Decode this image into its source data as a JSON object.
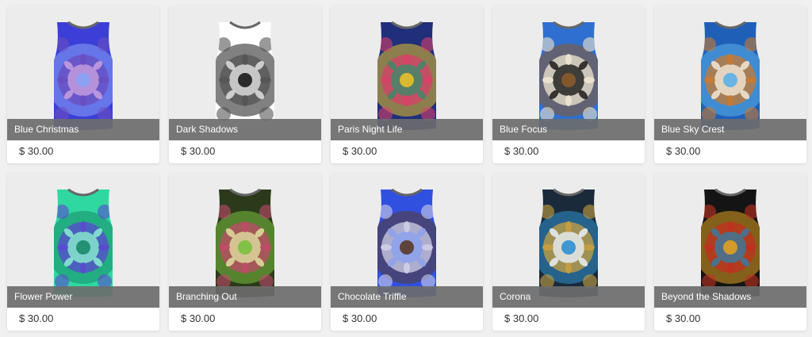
{
  "products": [
    {
      "name": "Blue Christmas",
      "price": "$ 30.00",
      "colors": [
        "#3b3fd8",
        "#8aa2f5",
        "#6a4ec0",
        "#c8a0e0"
      ]
    },
    {
      "name": "Dark Shadows",
      "price": "$ 30.00",
      "colors": [
        "#ffffff",
        "#1a1a1a",
        "#555555",
        "#e0e0e0"
      ]
    },
    {
      "name": "Paris Night Life",
      "price": "$ 30.00",
      "colors": [
        "#1f2f7a",
        "#e8c02a",
        "#d8406a",
        "#3a8a6a"
      ]
    },
    {
      "name": "Blue Focus",
      "price": "$ 30.00",
      "colors": [
        "#2f6fd0",
        "#8a5a2a",
        "#f0e6d0",
        "#1a1a1a"
      ]
    },
    {
      "name": "Blue Sky Crest",
      "price": "$ 30.00",
      "colors": [
        "#1f5fb8",
        "#5ab0e8",
        "#c87a30",
        "#f2e8d8"
      ]
    },
    {
      "name": "Flower Power",
      "price": "$ 30.00",
      "colors": [
        "#2fd8a0",
        "#1a8a6a",
        "#5a4ad0",
        "#8af0d0"
      ]
    },
    {
      "name": "Branching Out",
      "price": "$ 30.00",
      "colors": [
        "#2a3a1a",
        "#7ac040",
        "#c04a6a",
        "#e0e0a0"
      ]
    },
    {
      "name": "Chocolate Triffle",
      "price": "$ 30.00",
      "colors": [
        "#3050e0",
        "#5a3a2a",
        "#d0d0e8",
        "#8aa0f0"
      ]
    },
    {
      "name": "Corona",
      "price": "$ 30.00",
      "colors": [
        "#1a2a3a",
        "#2f8fd0",
        "#c8a040",
        "#e8f0f8"
      ]
    },
    {
      "name": "Beyond the Shadows",
      "price": "$ 30.00",
      "colors": [
        "#141414",
        "#e0a020",
        "#c03020",
        "#3a7aa0"
      ]
    }
  ]
}
